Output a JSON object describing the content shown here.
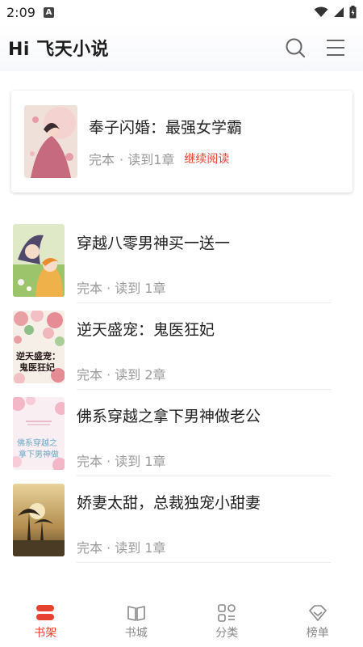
{
  "status_bar": {
    "time": "2:09",
    "badge": "A",
    "icons": [
      "wifi-icon",
      "signal-icon",
      "battery-icon"
    ]
  },
  "header": {
    "title": "Hi 飞天小说",
    "icons": [
      "search-icon",
      "menu-icon"
    ]
  },
  "featured": {
    "title": "奉子闪婚：最强女学霸",
    "status": "完本",
    "progress": "· 读到1章",
    "continue_label": "继续阅读"
  },
  "books": [
    {
      "title": "穿越八零男神买一送一",
      "meta": "完本 · 读到 1章"
    },
    {
      "title": "逆天盛宠：鬼医狂妃",
      "meta": "完本 · 读到 2章",
      "cover_text": "逆天盛宠：鬼医狂妃"
    },
    {
      "title": "佛系穿越之拿下男神做老公",
      "meta": "完本 · 读到 1章",
      "cover_text": "佛系穿越之拿下男神做"
    },
    {
      "title": "娇妻太甜，总裁独宠小甜妻",
      "meta": "完本 · 读到 1章"
    }
  ],
  "tabs": [
    {
      "label": "书架",
      "icon": "bookshelf-icon",
      "active": true
    },
    {
      "label": "书城",
      "icon": "book-open-icon",
      "active": false
    },
    {
      "label": "分类",
      "icon": "category-icon",
      "active": false
    },
    {
      "label": "榜单",
      "icon": "ranking-icon",
      "active": false
    }
  ],
  "colors": {
    "accent": "#e5432f",
    "muted": "#9a9a9a",
    "title": "#222222"
  }
}
